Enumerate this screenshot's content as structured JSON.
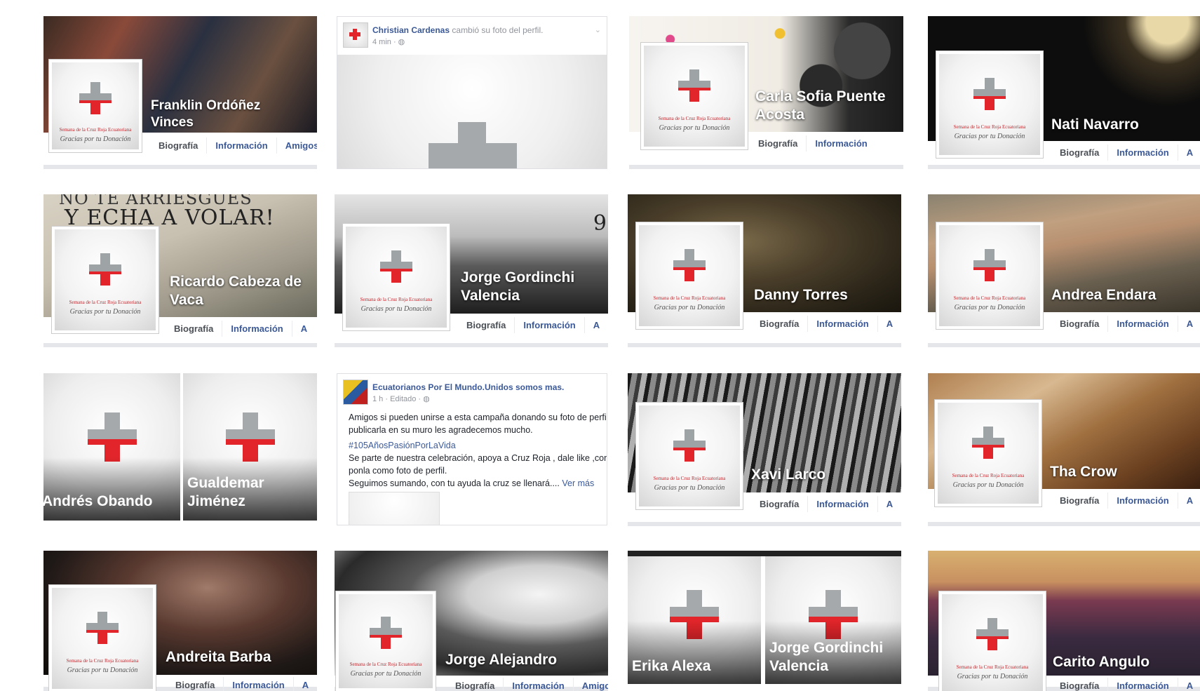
{
  "avatar": {
    "line1": "Semana de la Cruz Roja Ecuatoriana",
    "line2": "Gracias por tu Donación"
  },
  "tabs": {
    "biografia": "Biografía",
    "informacion": "Información",
    "amigos": "Amigos",
    "amigos_cut": "Amigos",
    "partial": "A"
  },
  "profiles": [
    {
      "name": "Franklin Ordóñez Vinces"
    },
    {
      "name": "Carla Sofia Puente Acosta"
    },
    {
      "name": "Nati Navarro"
    },
    {
      "name": "Ricardo Cabeza de Vaca"
    },
    {
      "name": "Jorge Gordinchi Valencia"
    },
    {
      "name": "Danny Torres"
    },
    {
      "name": "Andrea Endara"
    },
    {
      "name": "Xavi Larco"
    },
    {
      "name": "Tha Crow"
    },
    {
      "name": "Andreita Barba"
    },
    {
      "name": "Jorge Alejandro"
    },
    {
      "name": "Carito Angulo"
    }
  ],
  "halves": {
    "andres": "Andrés Obando",
    "gualdemar": "Gualdemar Jiménez",
    "erika": "Erika Alexa",
    "jorge": "Jorge Gordinchi Valencia"
  },
  "post1": {
    "author": "Christian Cardenas",
    "action": "cambió su foto del perfil.",
    "meta": "4 min · ◍"
  },
  "post2": {
    "author": "Ecuatorianos Por El Mundo.Unidos somos mas.",
    "meta": "1 h · Editado · ◍",
    "line1": "Amigos si pueden unirse a esta campaña donando su foto de perfil c",
    "line2": "publicarla en su muro les agradecemos mucho.",
    "hashtag": "#105AñosPasiónPorLaVida",
    "line3": "Se parte de nuestra celebración, apoya a Cruz Roja , dale like ,comp",
    "line4": "ponla como foto de perfil.",
    "line5": "Seguimos sumando, con tu ayuda la cruz se llenará....",
    "more": "Ver más"
  },
  "cover_texts": {
    "ricardo_cover_line1": "NO TE ARRIESGUES",
    "ricardo_cover_line2": "Y ECHA A VOLAR!",
    "jorge_cover_num": "9"
  }
}
